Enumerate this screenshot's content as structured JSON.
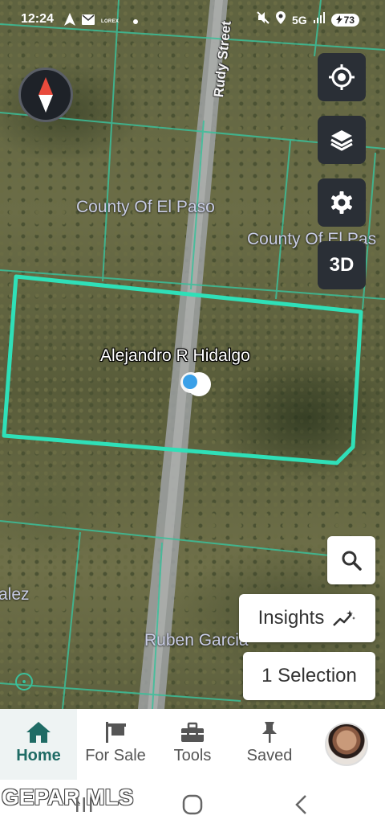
{
  "status_bar": {
    "time": "12:24",
    "brand": "LOREX",
    "network": "5G",
    "battery": "73"
  },
  "map": {
    "street_name": "Rudy Street",
    "labels": [
      "County Of El Paso",
      "County Of El Pas",
      "Alejandro R Hidalgo",
      "alez",
      "Ruben Garcia"
    ],
    "boundary_color": "#2fe0b8",
    "parcel_line_color": "#3bbf9a"
  },
  "controls": {
    "compass_icon": "compass-icon",
    "locate_icon": "crosshair-icon",
    "layers_icon": "layers-icon",
    "settings_icon": "gear-icon",
    "three_d_label": "3D",
    "search_icon": "search-icon",
    "insights_label": "Insights",
    "insights_icon": "sparkle-chart-icon",
    "selection_label": "1 Selection"
  },
  "bottom_nav": {
    "items": [
      {
        "label": "Home",
        "icon": "home-icon",
        "active": true
      },
      {
        "label": "For Sale",
        "icon": "flag-icon",
        "active": false
      },
      {
        "label": "Tools",
        "icon": "toolbox-icon",
        "active": false
      },
      {
        "label": "Saved",
        "icon": "pin-icon",
        "active": false
      }
    ],
    "active_color": "#1f6b65"
  },
  "watermark": "GEPAR MLS"
}
